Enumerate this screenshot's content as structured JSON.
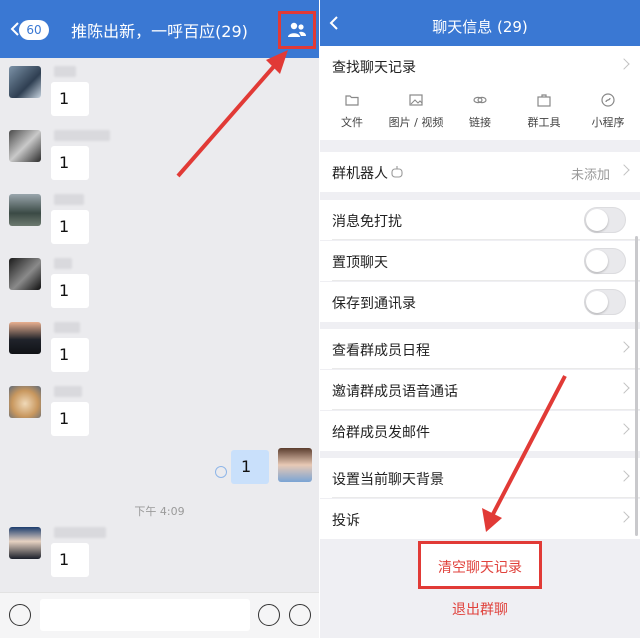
{
  "colors": {
    "header_blue": "#3a78d3",
    "danger_red": "#e0423c",
    "highlight_red": "#e13a36"
  },
  "chat": {
    "title": "推陈出新，一呼百应(29)",
    "unread_count": "60",
    "messages": [
      {
        "text": "1"
      },
      {
        "text": "1"
      },
      {
        "text": "1"
      },
      {
        "text": "1"
      },
      {
        "text": "1"
      },
      {
        "text": "1"
      }
    ],
    "self_message": "1",
    "time_separator": "下午 4:09",
    "last_message": "1"
  },
  "info": {
    "title": "聊天信息 (29)",
    "search_history": "查找聊天记录",
    "tools": [
      {
        "label": "文件",
        "icon": "folder-icon"
      },
      {
        "label": "图片 / 视频",
        "icon": "image-icon"
      },
      {
        "label": "链接",
        "icon": "link-icon"
      },
      {
        "label": "群工具",
        "icon": "toolbox-icon"
      },
      {
        "label": "小程序",
        "icon": "mini-program-icon"
      }
    ],
    "bot": {
      "label": "群机器人",
      "value": "未添加"
    },
    "toggles": [
      {
        "label": "消息免打扰",
        "on": false
      },
      {
        "label": "置顶聊天",
        "on": false
      },
      {
        "label": "保存到通讯录",
        "on": false
      }
    ],
    "group_rows": [
      "查看群成员日程",
      "邀请群成员语音通话",
      "给群成员发邮件"
    ],
    "setting_rows": [
      "设置当前聊天背景",
      "投诉"
    ],
    "clear_history": "清空聊天记录",
    "exit_group": "退出群聊"
  }
}
